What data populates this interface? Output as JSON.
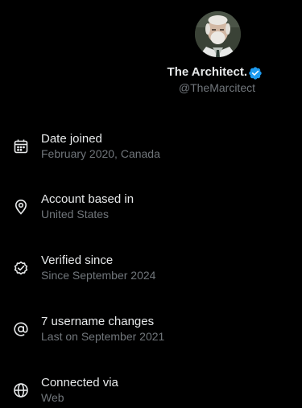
{
  "profile": {
    "display_name": "The Architect.",
    "handle": "@TheMarcitect",
    "verified_color": "#1d9bf0"
  },
  "info": [
    {
      "icon": "calendar-icon",
      "title": "Date joined",
      "subtitle": "February 2020, Canada"
    },
    {
      "icon": "location-pin-icon",
      "title": "Account based in",
      "subtitle": "United States"
    },
    {
      "icon": "verified-check-icon",
      "title": "Verified since",
      "subtitle": "Since September 2024"
    },
    {
      "icon": "at-sign-icon",
      "title": "7 username changes",
      "subtitle": "Last on September 2021"
    },
    {
      "icon": "globe-icon",
      "title": "Connected via",
      "subtitle": "Web"
    }
  ]
}
